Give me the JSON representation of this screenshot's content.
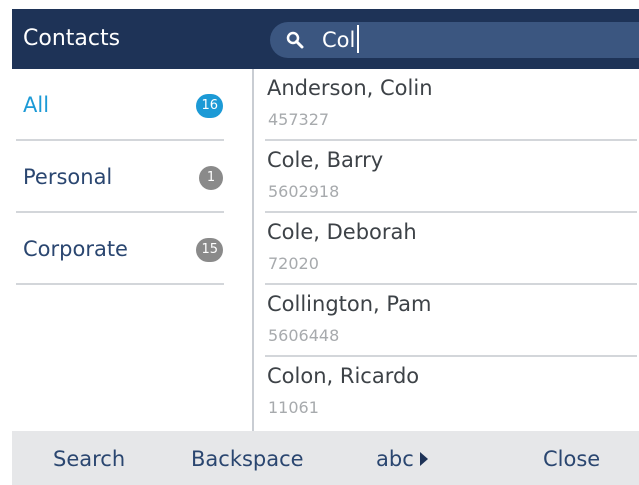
{
  "header": {
    "title": "Contacts",
    "search": {
      "value": "Col",
      "icon": "search-icon"
    }
  },
  "categories": [
    {
      "label": "All",
      "count": "16",
      "active": true
    },
    {
      "label": "Personal",
      "count": "1",
      "active": false
    },
    {
      "label": "Corporate",
      "count": "15",
      "active": false
    }
  ],
  "contacts": [
    {
      "name": "Anderson, Colin",
      "number": "457327"
    },
    {
      "name": "Cole, Barry",
      "number": "5602918"
    },
    {
      "name": "Cole, Deborah",
      "number": "72020"
    },
    {
      "name": "Collington, Pam",
      "number": "5606448"
    },
    {
      "name": "Colon, Ricardo",
      "number": "11061"
    }
  ],
  "softkeys": {
    "search": "Search",
    "backspace": "Backspace",
    "abc": "abc",
    "close": "Close"
  },
  "colors": {
    "header_bg": "#1e3357",
    "accent": "#1c9ad6",
    "badge_gray": "#8a8a8a"
  }
}
